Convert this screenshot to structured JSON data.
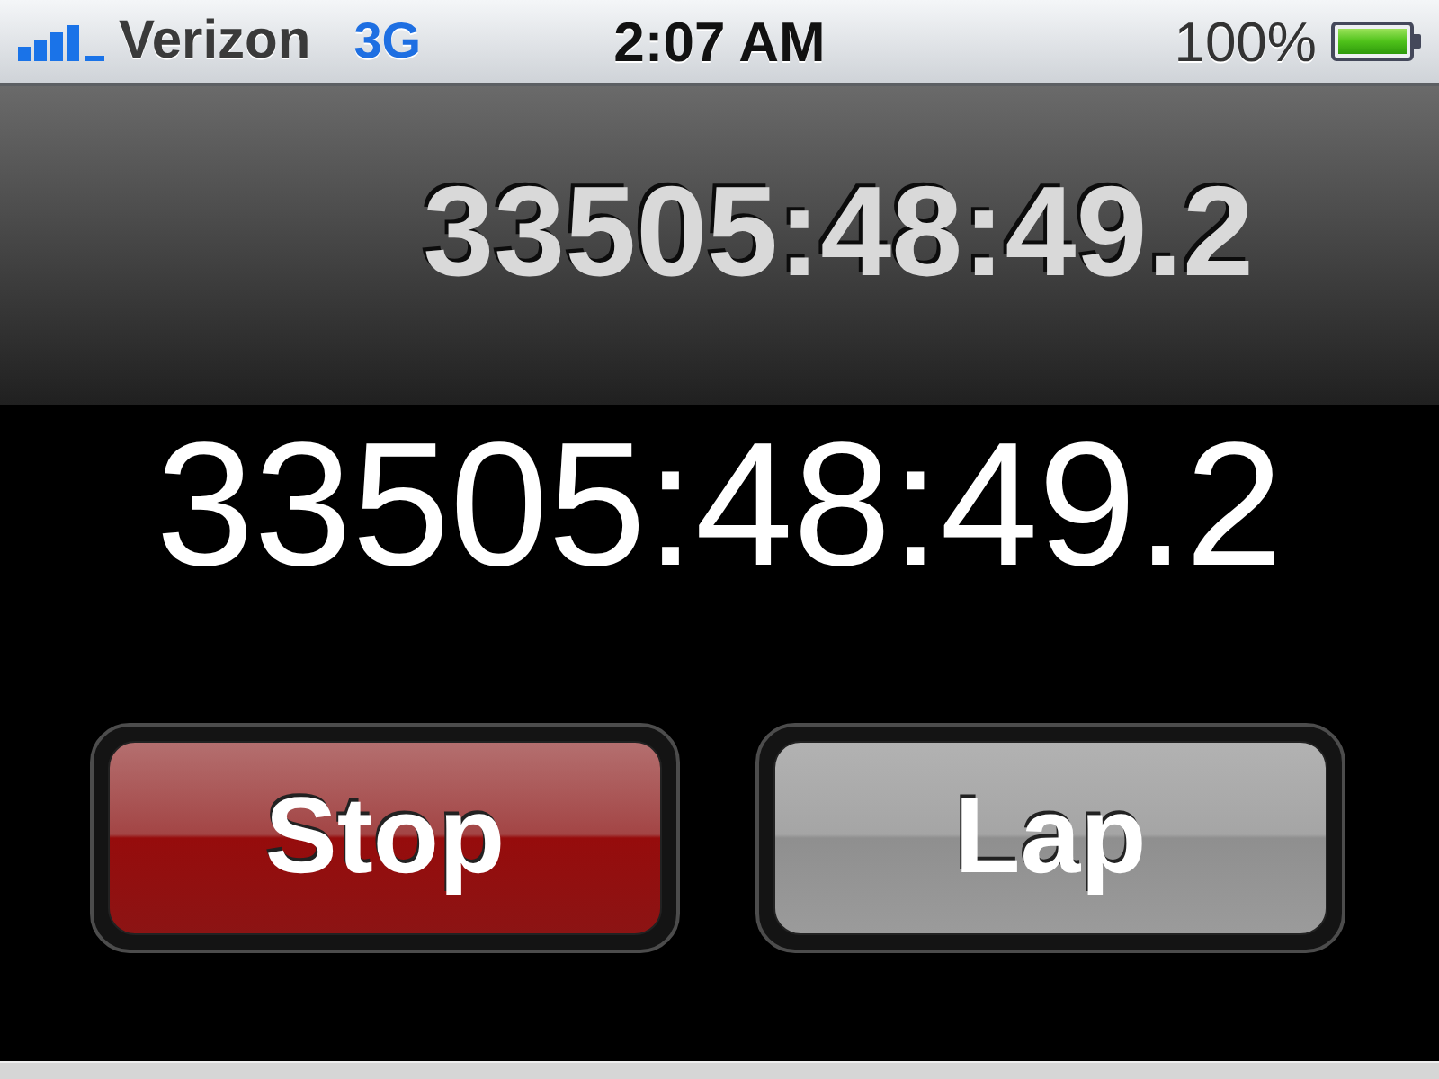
{
  "status_bar": {
    "carrier": "Verizon",
    "network": "3G",
    "time": "2:07 AM",
    "battery": "100%"
  },
  "lap_display": {
    "time": "33505:48:49.2"
  },
  "main_display": {
    "time": "33505:48:49.2"
  },
  "buttons": [
    {
      "label": "Stop",
      "kind": "stop"
    },
    {
      "label": "Lap",
      "kind": "lap"
    }
  ]
}
